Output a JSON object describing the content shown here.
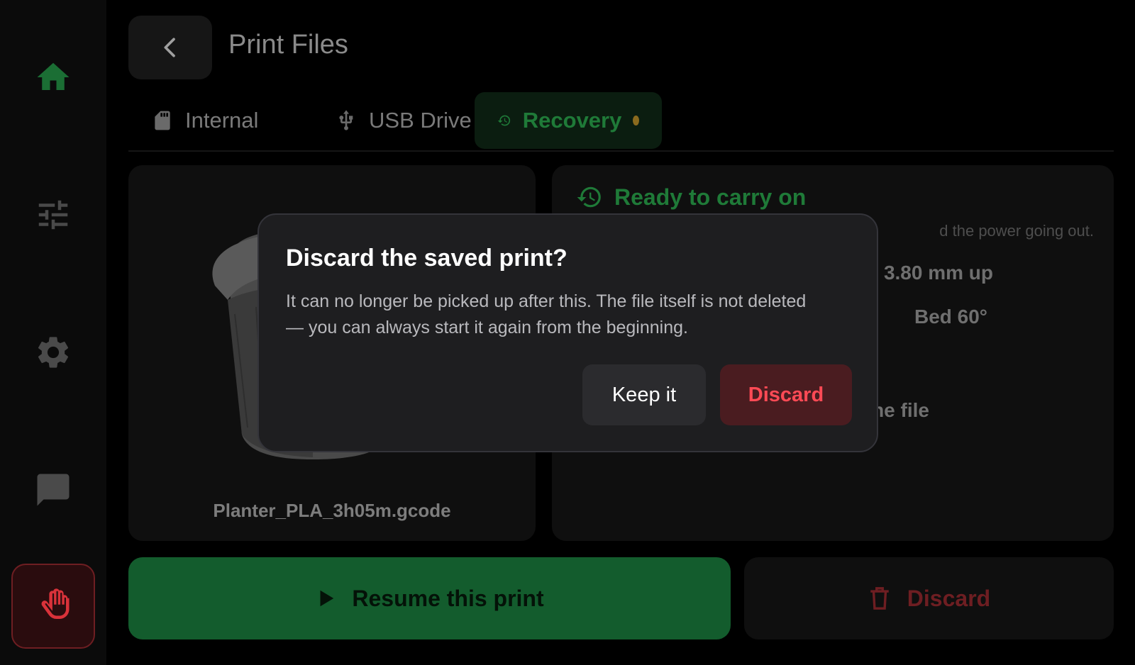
{
  "header": {
    "title": "Print Files"
  },
  "tabs": [
    {
      "label": "Internal",
      "icon": "sd-card-icon",
      "active": false
    },
    {
      "label": "USB Drive",
      "icon": "usb-icon",
      "active": false
    },
    {
      "label": "Recovery",
      "icon": "history-icon",
      "active": true,
      "has_indicator": true
    }
  ],
  "preview": {
    "filename": "Planter_PLA_3h05m.gcode"
  },
  "info": {
    "title": "Ready to carry on",
    "description_fragment": "d the power going out.",
    "height_fragment": "3.80 mm up",
    "temps_fragment": "Bed 60°",
    "source_fragment": "he file"
  },
  "actions": {
    "resume_label": "Resume this print",
    "discard_label": "Discard"
  },
  "dialog": {
    "title": "Discard the saved print?",
    "body": "It can no longer be picked up after this. The file itself is not deleted — you can always start it again from the beginning.",
    "keep_label": "Keep it",
    "confirm_label": "Discard"
  },
  "colors": {
    "accent_green": "#1f7a38",
    "resume_green": "#135c2d",
    "danger_red": "#ff4a55",
    "indicator_amber": "#8a6a1e"
  }
}
